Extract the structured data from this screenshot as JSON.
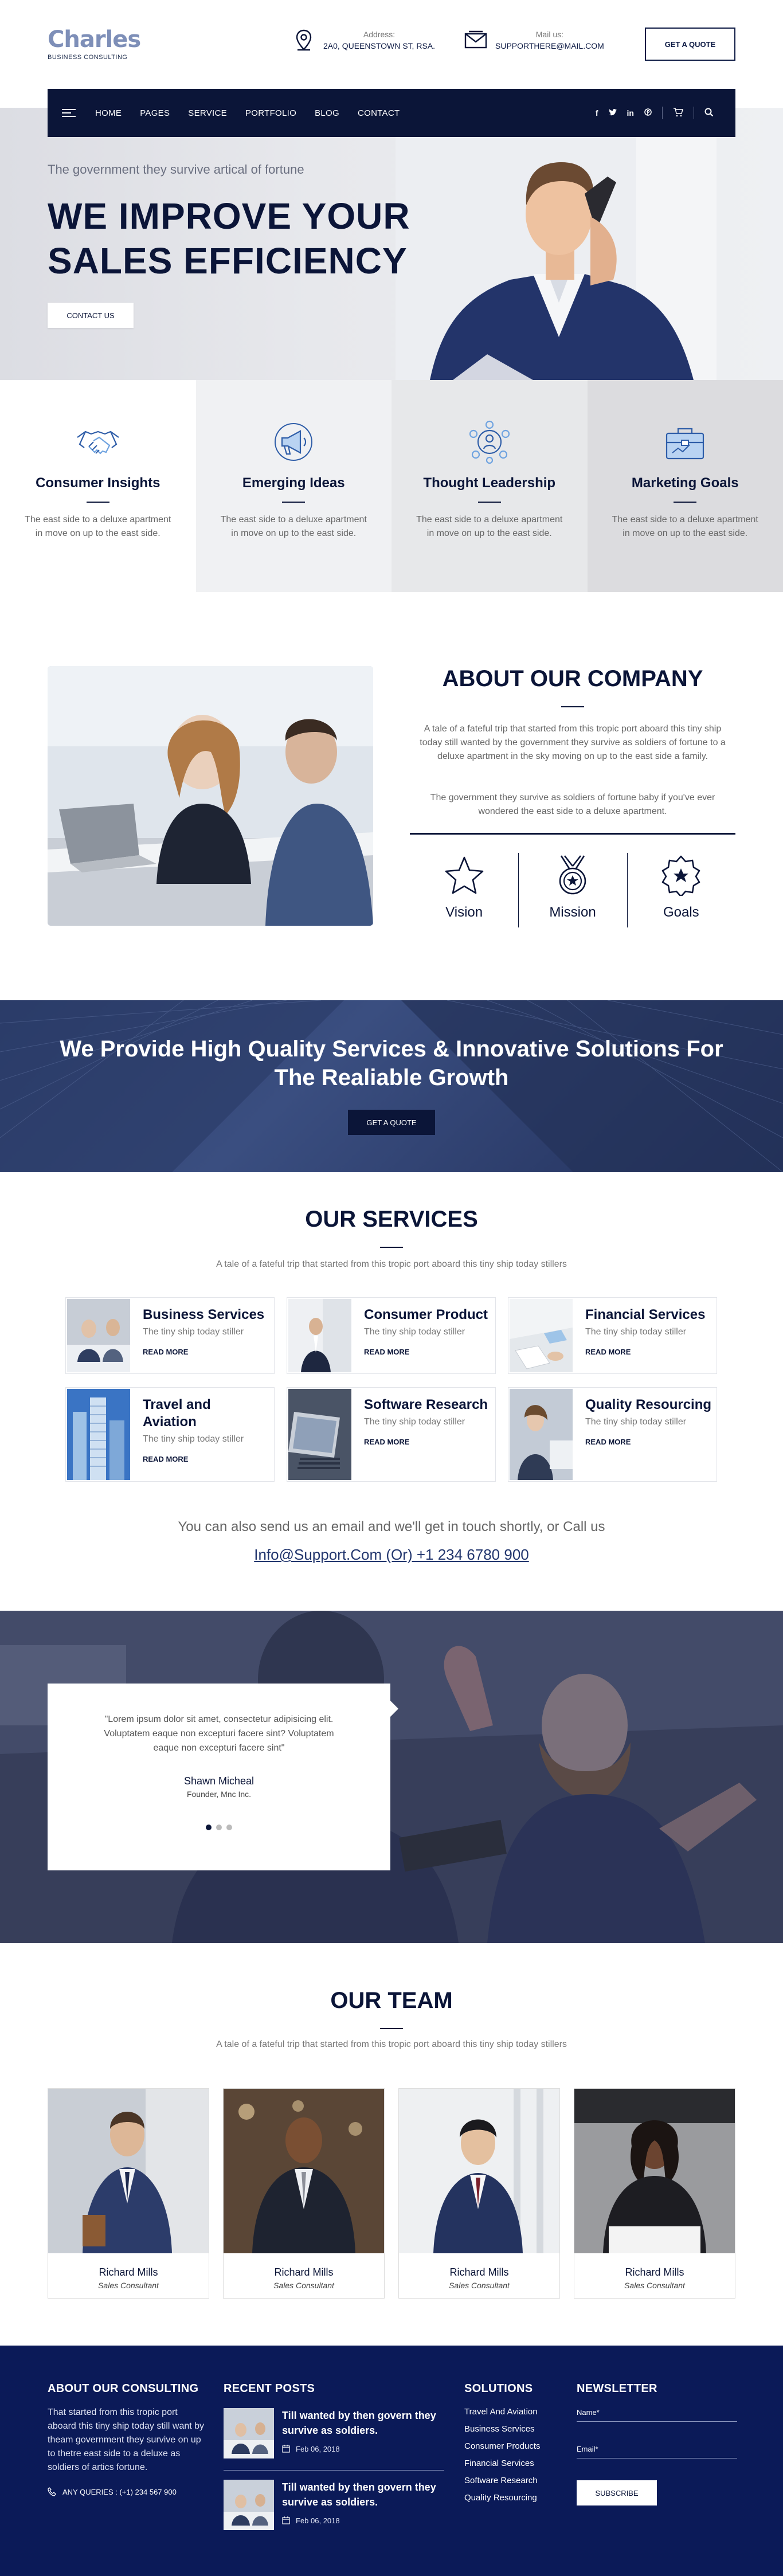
{
  "brand": {
    "name": "Charles",
    "tagline": "BUSINESS CONSULTING"
  },
  "header": {
    "address_label": "Address:",
    "address_value": "2A0, QUEENSTOWN ST, RSA.",
    "mail_label": "Mail us:",
    "mail_value": "SUPPORTHERE@MAIL.COM",
    "quote_button": "GET A QUOTE"
  },
  "nav": {
    "items": [
      "HOME",
      "PAGES",
      "SERVICE",
      "PORTFOLIO",
      "BLOG",
      "CONTACT"
    ],
    "social": [
      "f",
      "t",
      "in",
      "p"
    ]
  },
  "hero": {
    "tagline": "The government they survive artical of fortune",
    "title_line1": "WE IMPROVE YOUR",
    "title_line2": "SALES EFFICIENCY",
    "button": "CONTACT US"
  },
  "features": [
    {
      "title": "Consumer Insights",
      "text": "The east side to a deluxe apartment in move on up to the east side.",
      "icon": "handshake-icon"
    },
    {
      "title": "Emerging Ideas",
      "text": "The east side to a deluxe apartment in move on up to the east side.",
      "icon": "megaphone-icon"
    },
    {
      "title": "Thought Leadership",
      "text": "The east side to a deluxe apartment in move on up to the east side.",
      "icon": "network-icon"
    },
    {
      "title": "Marketing Goals",
      "text": "The east side to a deluxe apartment in move on up to the east side.",
      "icon": "briefcase-icon"
    }
  ],
  "about": {
    "title": "ABOUT OUR COMPANY",
    "para1": "A tale of a fateful trip that started from this tropic port aboard this tiny ship today still wanted by the government they survive as soldiers of fortune to a deluxe apartment in the sky moving on up to the east side a family.",
    "para2": "The government they survive as soldiers of fortune baby if you've ever wondered the east side to a deluxe apartment.",
    "items": [
      "Vision",
      "Mission",
      "Goals"
    ]
  },
  "banner": {
    "title_line1": "We Provide High Quality Services & Innovative Solutions For",
    "title_line2": "The Realiable Growth",
    "button": "GET A QUOTE"
  },
  "services": {
    "title": "OUR SERVICES",
    "subtitle": "A tale of a fateful trip that started from this tropic port aboard this tiny ship today stillers",
    "items": [
      {
        "title": "Business Services",
        "text": "The tiny ship today stiller",
        "link": "READ MORE"
      },
      {
        "title": "Consumer Product",
        "text": "The tiny ship today stiller",
        "link": "READ MORE"
      },
      {
        "title": "Financial Services",
        "text": "The tiny ship today stiller",
        "link": "READ MORE"
      },
      {
        "title": "Travel and Aviation",
        "text": "The tiny ship today stiller",
        "link": "READ MORE"
      },
      {
        "title": "Software Research",
        "text": "The tiny ship today stiller",
        "link": "READ MORE"
      },
      {
        "title": "Quality Resourcing",
        "text": "The tiny ship today stiller",
        "link": "READ MORE"
      }
    ],
    "cta_text": "You can also send us an email and we'll get in touch shortly, or Call us",
    "cta_link": "Info@Support.Com (Or) +1 234 6780 900"
  },
  "testimonial": {
    "quote": "\"Lorem ipsum dolor sit amet, consectetur adipisicing elit. Voluptatem eaque non excepturi facere sint? Voluptatem eaque non excepturi facere sint\"",
    "name": "Shawn Micheal",
    "role": "Founder, Mnc Inc."
  },
  "team": {
    "title": "OUR TEAM",
    "subtitle": "A tale of a fateful trip that started from this tropic port aboard this tiny ship today stillers",
    "members": [
      {
        "name": "Richard Mills",
        "role": "Sales Consultant"
      },
      {
        "name": "Richard Mills",
        "role": "Sales Consultant"
      },
      {
        "name": "Richard Mills",
        "role": "Sales Consultant"
      },
      {
        "name": "Richard Mills",
        "role": "Sales Consultant"
      }
    ]
  },
  "footer": {
    "about_title": "ABOUT OUR CONSULTING",
    "about_text": "That started from this tropic port aboard this tiny ship today still want by theam government they survive on up to thetre east side to a deluxe as soldiers of artics fortune.",
    "phone": "ANY QUERIES : (+1) 234 567 900",
    "posts_title": "RECENT POSTS",
    "posts": [
      {
        "title": "Till wanted by then govern they survive as soldiers.",
        "date": "Feb 06, 2018"
      },
      {
        "title": "Till wanted by then govern they survive as soldiers.",
        "date": "Feb 06, 2018"
      }
    ],
    "solutions_title": "SOLUTIONS",
    "solutions": [
      "Travel And Aviation",
      "Business Services",
      "Consumer Products",
      "Financial Services",
      "Software Research",
      "Quality Resourcing"
    ],
    "newsletter_title": "NEWSLETTER",
    "name_label": "Name*",
    "email_label": "Email*",
    "subscribe": "SUBSCRIBE"
  }
}
